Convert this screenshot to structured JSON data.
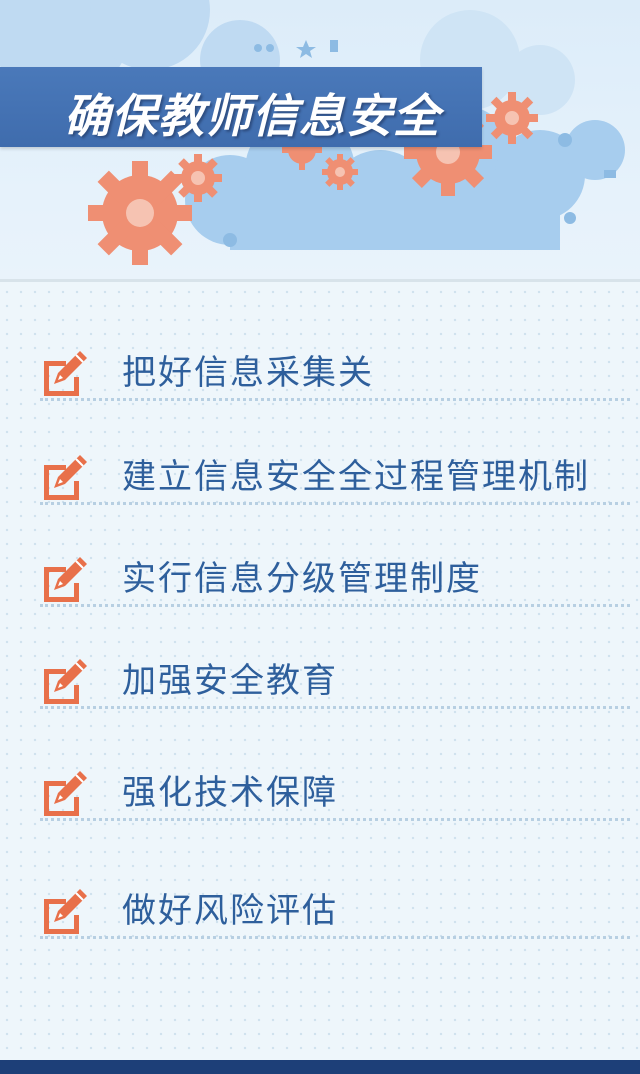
{
  "header": {
    "title": "确保教师信息安全"
  },
  "items": [
    {
      "label": "把好信息采集关",
      "icon": "pencil-note-icon"
    },
    {
      "label": "建立信息安全全过程管理机制",
      "icon": "pencil-note-icon"
    },
    {
      "label": "实行信息分级管理制度",
      "icon": "pencil-note-icon"
    },
    {
      "label": "加强安全教育",
      "icon": "pencil-note-icon"
    },
    {
      "label": "强化技术保障",
      "icon": "pencil-note-icon"
    },
    {
      "label": "做好风险评估",
      "icon": "pencil-note-icon"
    }
  ],
  "colors": {
    "title_bar": "#4a79ba",
    "item_text": "#2e5f9c",
    "icon": "#e8704a",
    "footer": "#1d3f78"
  }
}
